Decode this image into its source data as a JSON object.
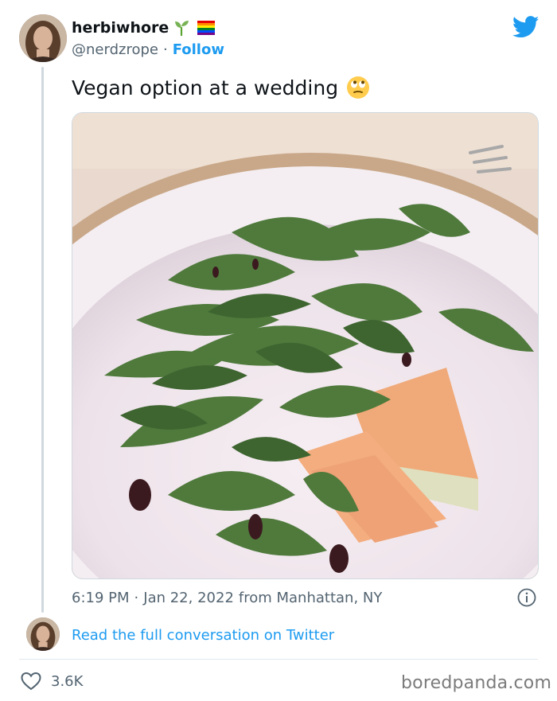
{
  "tweet": {
    "display_name": "herbiwhore",
    "handle": "@nerdzrope",
    "separator": "·",
    "follow_label": "Follow",
    "text": "Vegan option at a wedding",
    "time": "6:19 PM",
    "date": "Jan 22, 2022",
    "location": "from Manhattan, NY",
    "read_more": "Read the full conversation on Twitter",
    "likes": "3.6K"
  },
  "icons": {
    "name_emojis": [
      "seedling-emoji",
      "rainbow-flag-emoji"
    ],
    "text_emoji": "eye-roll-emoji",
    "brand": "twitter-bird-icon",
    "info": "info-icon",
    "like": "heart-icon"
  },
  "colors": {
    "accent": "#1d9bf0",
    "text": "#0f1419",
    "muted": "#536471",
    "border": "#cfd9de"
  },
  "watermark": "boredpanda.com"
}
